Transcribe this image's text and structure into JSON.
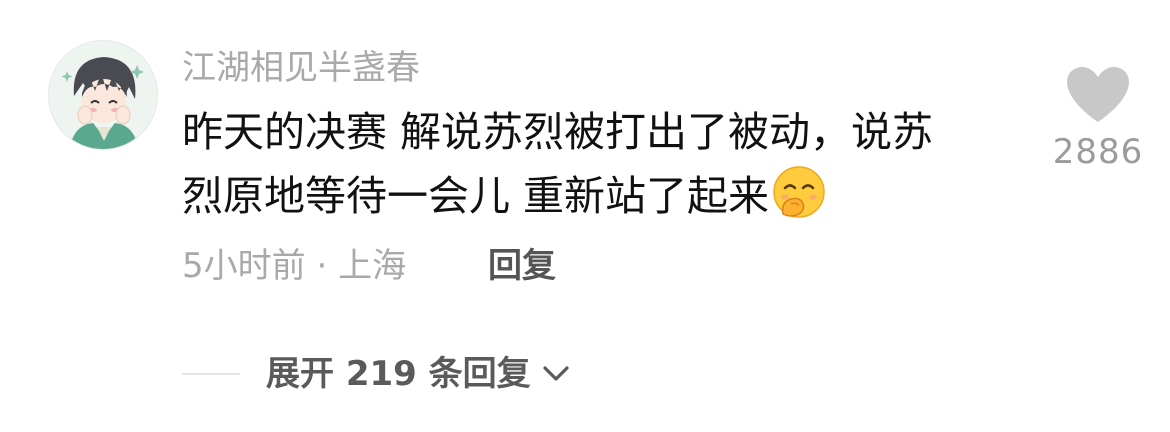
{
  "comment": {
    "username": "江湖相见半盏春",
    "text_line1": "昨天的决赛 解说苏烈被打出了被动，说苏",
    "text_line2": "烈原地等待一会儿 重新站了起来",
    "emoji": "smirk-hand-over-mouth-emoji",
    "time": "5小时前",
    "location": "上海",
    "meta_separator": "·",
    "reply_label": "回复",
    "like_count": "2886"
  },
  "replies": {
    "expand_label": "展开 219 条回复"
  },
  "colors": {
    "like_heart": "#c8c8c8",
    "secondary_text": "#a9a9a9",
    "primary_text": "#111111"
  }
}
